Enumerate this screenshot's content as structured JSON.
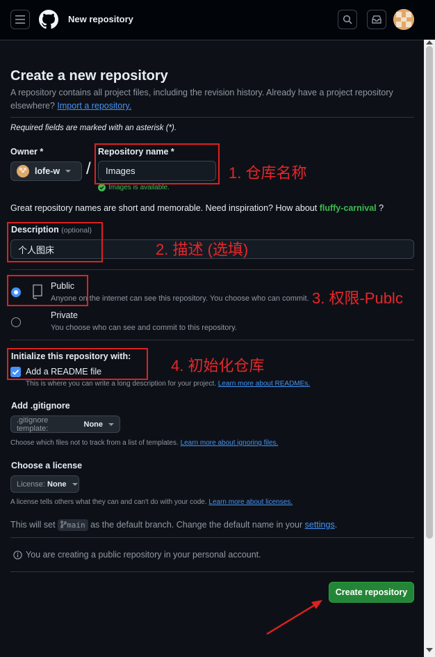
{
  "header": {
    "title": "New repository"
  },
  "page": {
    "heading": "Create a new repository",
    "intro": "A repository contains all project files, including the revision history. Already have a project repository",
    "intro_cont": "elsewhere?",
    "import_link": "Import a repository.",
    "required_note": "Required fields are marked with an asterisk (*)."
  },
  "owner": {
    "label": "Owner *",
    "value": "lofe-w"
  },
  "repo_name": {
    "label": "Repository name *",
    "value": "Images",
    "available": "Images is available."
  },
  "separator": "/",
  "inspiration": {
    "text": "Great repository names are short and memorable. Need inspiration? How about",
    "suggestion": "fluffy-carnival",
    "end": "?"
  },
  "description": {
    "label": "Description",
    "optional": "(optional)",
    "value": "个人图床"
  },
  "visibility": {
    "public_label": "Public",
    "public_desc": "Anyone on the internet can see this repository. You choose who can commit.",
    "private_label": "Private",
    "private_desc": "You choose who can see and commit to this repository."
  },
  "init": {
    "label": "Initialize this repository with:",
    "readme_label": "Add a README file",
    "readme_desc": "This is where you can write a long description for your project.",
    "readme_link": "Learn more about READMEs."
  },
  "gitignore": {
    "label": "Add .gitignore",
    "select_prefix": ".gitignore template:",
    "select_value": "None",
    "desc": "Choose which files not to track from a list of templates.",
    "link": "Learn more about ignoring files."
  },
  "license": {
    "label": "Choose a license",
    "select_prefix": "License:",
    "select_value": "None",
    "desc": "A license tells others what they can and can't do with your code.",
    "link": "Learn more about licenses."
  },
  "branch": {
    "pre": "This will set",
    "name": "main",
    "mid": "as the default branch. Change the default name in your",
    "link": "settings",
    "end": "."
  },
  "notice": "You are creating a public repository in your personal account.",
  "create_button": "Create repository",
  "annotations": {
    "a1": "1. 仓库名称",
    "a2": "2. 描述 (选填)",
    "a3": "3. 权限-Publc",
    "a4": "4. 初始化仓库"
  },
  "colors": {
    "bg": "#0d1117",
    "header_bg": "#010409",
    "accent_green": "#238636",
    "link_blue": "#4493f8",
    "annotation_red": "#e02020"
  }
}
